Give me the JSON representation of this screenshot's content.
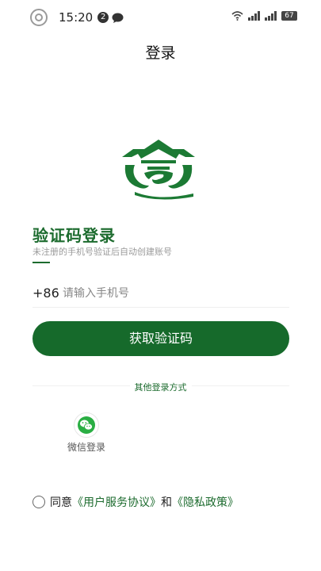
{
  "status_bar": {
    "time": "15:20",
    "notification_count": "2",
    "signal1_label": "ull",
    "signal2_label": "ull",
    "battery": "67",
    "icons": [
      "ring-icon",
      "chat-bubble-icon",
      "wifi-icon",
      "signal-icon",
      "signal-icon",
      "battery-icon"
    ]
  },
  "header": {
    "title": "登录"
  },
  "logo": {
    "icon": "building-roof-logo",
    "color": "#1c7a34"
  },
  "login": {
    "heading": "验证码登录",
    "subheading": "未注册的手机号验证后自动创建账号",
    "country_code": "+86",
    "phone_placeholder": "请输入手机号",
    "phone_value": "",
    "get_code_label": "获取验证码"
  },
  "other_login": {
    "label": "其他登录方式",
    "methods": [
      {
        "icon": "wechat-icon",
        "label": "微信登录"
      }
    ]
  },
  "agreement": {
    "prefix": "同意",
    "terms": "《用户服务协议》",
    "and": "和",
    "privacy": "《隐私政策》",
    "checked": false
  },
  "colors": {
    "accent": "#166a2b",
    "text": "#222222",
    "muted": "#9a9a9a"
  }
}
